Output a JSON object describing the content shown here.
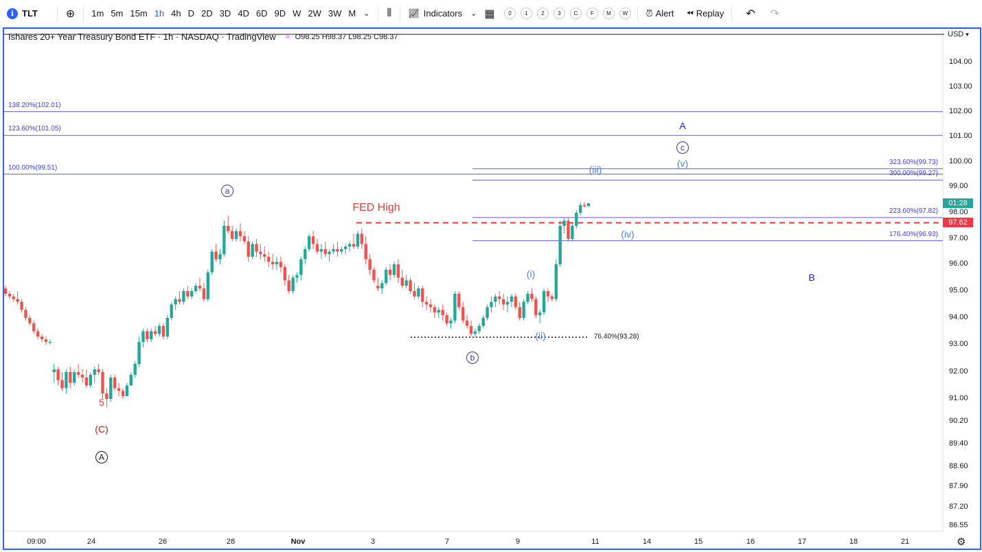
{
  "toolbar": {
    "symbol": "TLT",
    "intervals": [
      "1m",
      "5m",
      "15m",
      "1h",
      "4h",
      "D",
      "2D",
      "3D",
      "4D",
      "6D",
      "9D",
      "W",
      "2W",
      "3W",
      "M"
    ],
    "active_interval": "1h",
    "indicators_label": "Indicators",
    "layout_circles": [
      "0",
      "1",
      "2",
      "3",
      "C",
      "F",
      "M",
      "W"
    ],
    "alert_label": "Alert",
    "replay_label": "Replay",
    "icons": [
      "plus-circle-icon",
      "chevron-down-icon",
      "candles-icon",
      "indicators-icon",
      "layouts-icon",
      "alert-icon",
      "replay-icon",
      "undo-icon",
      "redo-icon"
    ]
  },
  "legend": {
    "title": "Ishares 20+ Year Treasury Bond ETF · 1h · NASDAQ · TradingView",
    "badge": "≈",
    "ohlc": "O98.25 H98.37 L98.25 C98.37"
  },
  "price_axis": {
    "currency": "USD",
    "ticks": [
      "104.00",
      "103.00",
      "102.00",
      "101.00",
      "100.00",
      "99.00",
      "98.00",
      "97.00",
      "96.00",
      "95.00",
      "94.00",
      "93.00",
      "92.00",
      "91.00",
      "90.20",
      "89.40",
      "88.60",
      "87.90",
      "87.20",
      "86.55"
    ],
    "countdown": "01:28",
    "last_price_tag": "97.62",
    "colors": {
      "countdown_bg": "#26a69a",
      "last_price_bg": "#f23645"
    }
  },
  "time_axis": {
    "ticks": [
      "09:00",
      "24",
      "26",
      "28",
      "Nov",
      "3",
      "7",
      "9",
      "11",
      "14",
      "15",
      "16",
      "17",
      "18",
      "21"
    ]
  },
  "fib_levels_left": [
    {
      "label": "138.20%(102.01)",
      "price": 102.01
    },
    {
      "label": "123.60%(101.05)",
      "price": 101.05
    },
    {
      "label": "100.00%(99.51)",
      "price": 99.51
    }
  ],
  "fib_levels_right": [
    {
      "label": "323.60%(99.73)",
      "price": 99.73
    },
    {
      "label": "300.00%(99.27)",
      "price": 99.27
    },
    {
      "label": "223.60%(97.82)",
      "price": 97.82
    },
    {
      "label": "176.40%(96.93)",
      "price": 96.93
    }
  ],
  "fib_retracement": {
    "label": "76.40%(93.28)",
    "price": 93.28
  },
  "fed_high": {
    "label": "FED High",
    "price": 97.62
  },
  "wave_labels": [
    {
      "text": "A",
      "style": "plain",
      "color": "#1f1fb5"
    },
    {
      "text": "c",
      "style": "circle",
      "color": "#3a3a8c"
    },
    {
      "text": "(v)",
      "style": "plain",
      "color": "#4f7fd9"
    },
    {
      "text": "(iii)",
      "style": "plain",
      "color": "#4f7fd9"
    },
    {
      "text": "(iv)",
      "style": "plain",
      "color": "#4f7fd9"
    },
    {
      "text": "(i)",
      "style": "plain",
      "color": "#4f7fd9"
    },
    {
      "text": "(ii)",
      "style": "plain",
      "color": "#4f7fd9"
    },
    {
      "text": "b",
      "style": "circle",
      "color": "#3a3a8c"
    },
    {
      "text": "a",
      "style": "circle",
      "color": "#3a3a8c"
    },
    {
      "text": "B",
      "style": "plain",
      "color": "#1f1fb5"
    },
    {
      "text": "5",
      "style": "plain",
      "color": "#e53935"
    },
    {
      "text": "(C)",
      "style": "plain",
      "color": "#b71c1c"
    },
    {
      "text": "A",
      "style": "circle",
      "color": "#131722"
    }
  ],
  "candle_colors": {
    "up": "#26a69a",
    "down": "#ef5350"
  },
  "chart_data": {
    "type": "candlestick",
    "title": "Ishares 20+ Year Treasury Bond ETF · 1h · NASDAQ · TradingView",
    "ylim": [
      86.55,
      104.6
    ],
    "ohlc": [
      [
        95.1,
        95.2,
        94.8,
        94.9
      ],
      [
        94.9,
        95.0,
        94.7,
        94.8
      ],
      [
        94.8,
        94.9,
        94.6,
        94.7
      ],
      [
        94.7,
        95.0,
        94.5,
        94.6
      ],
      [
        94.6,
        94.7,
        94.2,
        94.3
      ],
      [
        94.3,
        94.4,
        93.9,
        94.0
      ],
      [
        94.0,
        94.1,
        93.7,
        93.8
      ],
      [
        93.8,
        93.9,
        93.4,
        93.5
      ],
      [
        93.5,
        93.6,
        93.2,
        93.3
      ],
      [
        93.3,
        93.4,
        93.1,
        93.2
      ],
      [
        93.2,
        93.3,
        93.0,
        93.1
      ],
      [
        93.1,
        93.2,
        93.0,
        93.1
      ],
      [
        92.0,
        92.3,
        91.6,
        92.1
      ],
      [
        92.1,
        92.2,
        91.5,
        91.7
      ],
      [
        91.7,
        92.0,
        91.3,
        91.4
      ],
      [
        91.4,
        92.1,
        91.2,
        92.0
      ],
      [
        92.0,
        92.2,
        91.4,
        91.6
      ],
      [
        91.6,
        92.1,
        91.5,
        92.0
      ],
      [
        92.0,
        92.3,
        91.8,
        91.9
      ],
      [
        91.9,
        92.1,
        91.6,
        91.8
      ],
      [
        91.8,
        92.1,
        91.4,
        91.5
      ],
      [
        91.5,
        92.0,
        91.4,
        91.9
      ],
      [
        91.9,
        92.2,
        91.6,
        92.1
      ],
      [
        92.1,
        92.3,
        91.9,
        92.0
      ],
      [
        92.0,
        92.1,
        91.0,
        91.2
      ],
      [
        91.2,
        91.4,
        90.7,
        91.0
      ],
      [
        91.0,
        91.9,
        90.9,
        91.8
      ],
      [
        91.8,
        91.9,
        91.3,
        91.4
      ],
      [
        91.4,
        91.6,
        91.1,
        91.3
      ],
      [
        91.3,
        91.4,
        91.0,
        91.1
      ],
      [
        91.1,
        91.6,
        91.1,
        91.5
      ],
      [
        91.5,
        92.0,
        91.5,
        91.9
      ],
      [
        91.9,
        92.4,
        91.8,
        92.3
      ],
      [
        92.3,
        93.3,
        92.2,
        93.1
      ],
      [
        93.1,
        93.6,
        92.9,
        93.5
      ],
      [
        93.5,
        93.6,
        93.1,
        93.2
      ],
      [
        93.2,
        93.6,
        93.1,
        93.5
      ],
      [
        93.5,
        93.7,
        93.3,
        93.4
      ],
      [
        93.4,
        93.8,
        93.3,
        93.7
      ],
      [
        93.7,
        93.8,
        93.2,
        93.3
      ],
      [
        93.3,
        94.1,
        93.2,
        94.0
      ],
      [
        94.0,
        94.6,
        93.9,
        94.5
      ],
      [
        94.5,
        94.8,
        94.3,
        94.7
      ],
      [
        94.7,
        95.0,
        94.5,
        94.6
      ],
      [
        94.6,
        95.1,
        94.5,
        95.0
      ],
      [
        95.0,
        95.2,
        94.7,
        94.8
      ],
      [
        94.8,
        95.1,
        94.7,
        95.0
      ],
      [
        95.0,
        95.3,
        94.9,
        95.2
      ],
      [
        95.2,
        95.5,
        95.0,
        95.1
      ],
      [
        95.1,
        95.3,
        94.6,
        94.7
      ],
      [
        94.7,
        95.8,
        94.6,
        95.7
      ],
      [
        95.7,
        96.6,
        95.6,
        96.5
      ],
      [
        96.5,
        96.8,
        96.1,
        96.2
      ],
      [
        96.2,
        96.6,
        96.0,
        96.4
      ],
      [
        96.4,
        97.7,
        96.3,
        97.5
      ],
      [
        97.5,
        97.9,
        97.2,
        97.3
      ],
      [
        97.3,
        97.5,
        96.9,
        97.0
      ],
      [
        97.0,
        97.4,
        96.9,
        97.3
      ],
      [
        97.3,
        97.6,
        96.9,
        97.1
      ],
      [
        97.1,
        97.3,
        96.8,
        96.9
      ],
      [
        96.9,
        97.1,
        96.1,
        96.3
      ],
      [
        96.3,
        96.9,
        96.2,
        96.8
      ],
      [
        96.8,
        97.0,
        96.3,
        96.5
      ],
      [
        96.5,
        96.8,
        96.2,
        96.4
      ],
      [
        96.4,
        96.7,
        96.1,
        96.3
      ],
      [
        96.3,
        96.5,
        95.9,
        96.1
      ],
      [
        96.1,
        96.4,
        95.8,
        96.0
      ],
      [
        96.0,
        96.3,
        95.8,
        96.1
      ],
      [
        96.1,
        96.3,
        95.7,
        95.9
      ],
      [
        95.9,
        96.0,
        95.2,
        95.4
      ],
      [
        95.4,
        95.6,
        94.9,
        95.0
      ],
      [
        95.0,
        95.6,
        94.9,
        95.5
      ],
      [
        95.5,
        95.7,
        95.3,
        95.6
      ],
      [
        95.6,
        96.3,
        95.4,
        96.2
      ],
      [
        96.2,
        96.7,
        96.0,
        96.6
      ],
      [
        96.6,
        97.2,
        96.5,
        97.1
      ],
      [
        97.1,
        97.3,
        96.6,
        96.8
      ],
      [
        96.8,
        97.0,
        96.4,
        96.5
      ],
      [
        96.5,
        96.8,
        96.2,
        96.6
      ],
      [
        96.6,
        96.9,
        96.3,
        96.4
      ],
      [
        96.4,
        96.6,
        96.1,
        96.5
      ],
      [
        96.5,
        96.8,
        96.4,
        96.6
      ],
      [
        96.6,
        96.9,
        96.3,
        96.5
      ],
      [
        96.5,
        96.7,
        96.4,
        96.6
      ],
      [
        96.6,
        96.8,
        96.4,
        96.7
      ],
      [
        96.7,
        96.9,
        96.5,
        96.8
      ],
      [
        96.8,
        97.2,
        96.6,
        96.7
      ],
      [
        96.7,
        97.3,
        96.6,
        97.2
      ],
      [
        97.2,
        97.4,
        96.6,
        96.8
      ],
      [
        96.8,
        97.1,
        96.0,
        96.2
      ],
      [
        96.2,
        96.4,
        95.6,
        95.8
      ],
      [
        95.8,
        95.9,
        95.3,
        95.4
      ],
      [
        95.2,
        95.5,
        95.0,
        95.1
      ],
      [
        95.1,
        95.4,
        94.9,
        95.3
      ],
      [
        95.3,
        95.9,
        95.2,
        95.8
      ],
      [
        95.8,
        96.0,
        95.4,
        95.6
      ],
      [
        95.6,
        96.1,
        95.5,
        96.0
      ],
      [
        96.0,
        96.2,
        95.3,
        95.5
      ],
      [
        95.5,
        95.8,
        95.1,
        95.2
      ],
      [
        95.2,
        95.6,
        95.1,
        95.4
      ],
      [
        95.4,
        95.5,
        94.9,
        95.0
      ],
      [
        95.0,
        95.3,
        94.7,
        94.8
      ],
      [
        94.8,
        95.2,
        94.7,
        95.1
      ],
      [
        95.1,
        95.2,
        94.4,
        94.6
      ],
      [
        94.6,
        94.8,
        94.3,
        94.5
      ],
      [
        94.5,
        94.7,
        94.2,
        94.4
      ],
      [
        94.4,
        94.5,
        94.0,
        94.2
      ],
      [
        94.2,
        94.4,
        94.0,
        94.3
      ],
      [
        94.3,
        94.5,
        93.9,
        94.1
      ],
      [
        94.1,
        94.2,
        93.7,
        93.8
      ],
      [
        93.8,
        94.0,
        93.6,
        93.9
      ],
      [
        93.9,
        95.0,
        93.8,
        94.9
      ],
      [
        94.9,
        95.0,
        94.3,
        94.4
      ],
      [
        94.4,
        94.6,
        93.8,
        93.9
      ],
      [
        93.9,
        94.1,
        93.6,
        93.7
      ],
      [
        93.7,
        93.9,
        93.3,
        93.4
      ],
      [
        93.4,
        93.6,
        93.3,
        93.5
      ],
      [
        93.5,
        93.8,
        93.4,
        93.7
      ],
      [
        93.7,
        94.1,
        93.6,
        94.0
      ],
      [
        94.0,
        94.5,
        93.9,
        94.4
      ],
      [
        94.4,
        94.8,
        94.2,
        94.6
      ],
      [
        94.6,
        94.9,
        94.4,
        94.8
      ],
      [
        94.8,
        95.0,
        94.5,
        94.7
      ],
      [
        94.7,
        94.9,
        94.3,
        94.5
      ],
      [
        94.5,
        94.8,
        94.2,
        94.6
      ],
      [
        94.6,
        94.9,
        94.4,
        94.8
      ],
      [
        94.8,
        94.9,
        94.3,
        94.4
      ],
      [
        94.4,
        94.6,
        93.9,
        94.0
      ],
      [
        94.0,
        94.7,
        93.9,
        94.6
      ],
      [
        94.6,
        95.0,
        94.5,
        94.9
      ],
      [
        94.9,
        95.1,
        94.6,
        94.7
      ],
      [
        94.7,
        94.8,
        94.0,
        94.1
      ],
      [
        94.1,
        94.3,
        93.8,
        94.2
      ],
      [
        94.2,
        95.1,
        94.1,
        95.0
      ],
      [
        95.0,
        95.1,
        94.6,
        94.8
      ],
      [
        94.8,
        94.9,
        94.6,
        94.7
      ],
      [
        94.7,
        96.2,
        94.6,
        96.0
      ],
      [
        96.0,
        97.7,
        95.9,
        97.5
      ],
      [
        97.5,
        97.8,
        97.2,
        97.7
      ],
      [
        97.7,
        97.8,
        96.9,
        97.0
      ],
      [
        97.0,
        97.6,
        96.9,
        97.5
      ],
      [
        97.5,
        98.1,
        97.4,
        98.0
      ],
      [
        98.0,
        98.4,
        97.9,
        98.3
      ],
      [
        98.3,
        98.4,
        98.2,
        98.25
      ],
      [
        98.25,
        98.37,
        98.25,
        98.37
      ]
    ]
  }
}
